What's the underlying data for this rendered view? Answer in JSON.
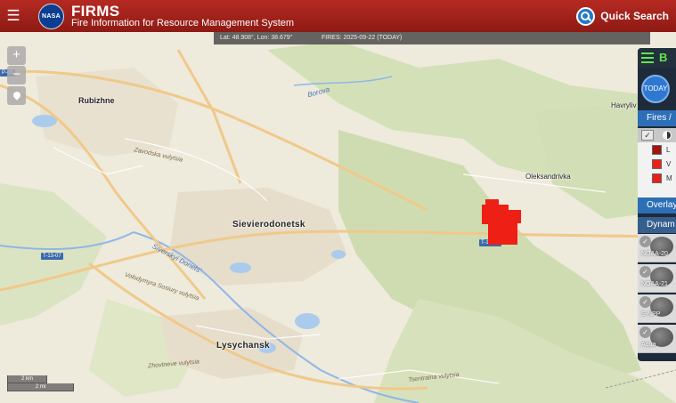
{
  "header": {
    "menu_icon": "menu-icon",
    "brand_logo_text": "NASA",
    "brand_title": "FIRMS",
    "brand_subtitle": "Fire Information for Resource Management System",
    "quick_search_label": "Quick Search",
    "quick_search_icon": "magnifier-icon",
    "bg_color": "#a32119"
  },
  "info_bar": {
    "coords": "Lat: 48.908°, Lon: 38.679°",
    "fires": "FIRES: 2025-09-22 (TODAY)"
  },
  "map": {
    "cities": [
      "Rubizhne",
      "Sievierodonetsk",
      "Lysychansk"
    ],
    "villages": [
      "Oleksandrivka",
      "Havryliv"
    ],
    "rivers": [
      "Borova",
      "Siverskyi Donets'"
    ],
    "roads": [
      "Zavodska vulytsia",
      "Volodymyra Sosiury vulytsia",
      "Zhovtneve vulytsia",
      "Tsentralna vulytsia"
    ],
    "route_shields": [
      "T-13-07",
      "T-13-07",
      "P-66"
    ],
    "controls": [
      "zoom-in",
      "zoom-out",
      "locate"
    ],
    "scale_km": "2 km",
    "scale_mi": "2 mi",
    "fire_color": "#ee1f14"
  },
  "panel": {
    "top_label": "B",
    "today_label": "TODAY",
    "fires_section": "Fires /",
    "legend": [
      {
        "label": "L",
        "color": "#a4130e"
      },
      {
        "label": "V",
        "color": "#ee1f14"
      },
      {
        "label": "M",
        "color": "#e81f14"
      }
    ],
    "overlays_section": "Overlay",
    "dynamic_section": "Dynam",
    "satellites": [
      "NOAA-20",
      "NOAA-21",
      "S-NPP",
      "Aqua"
    ]
  }
}
